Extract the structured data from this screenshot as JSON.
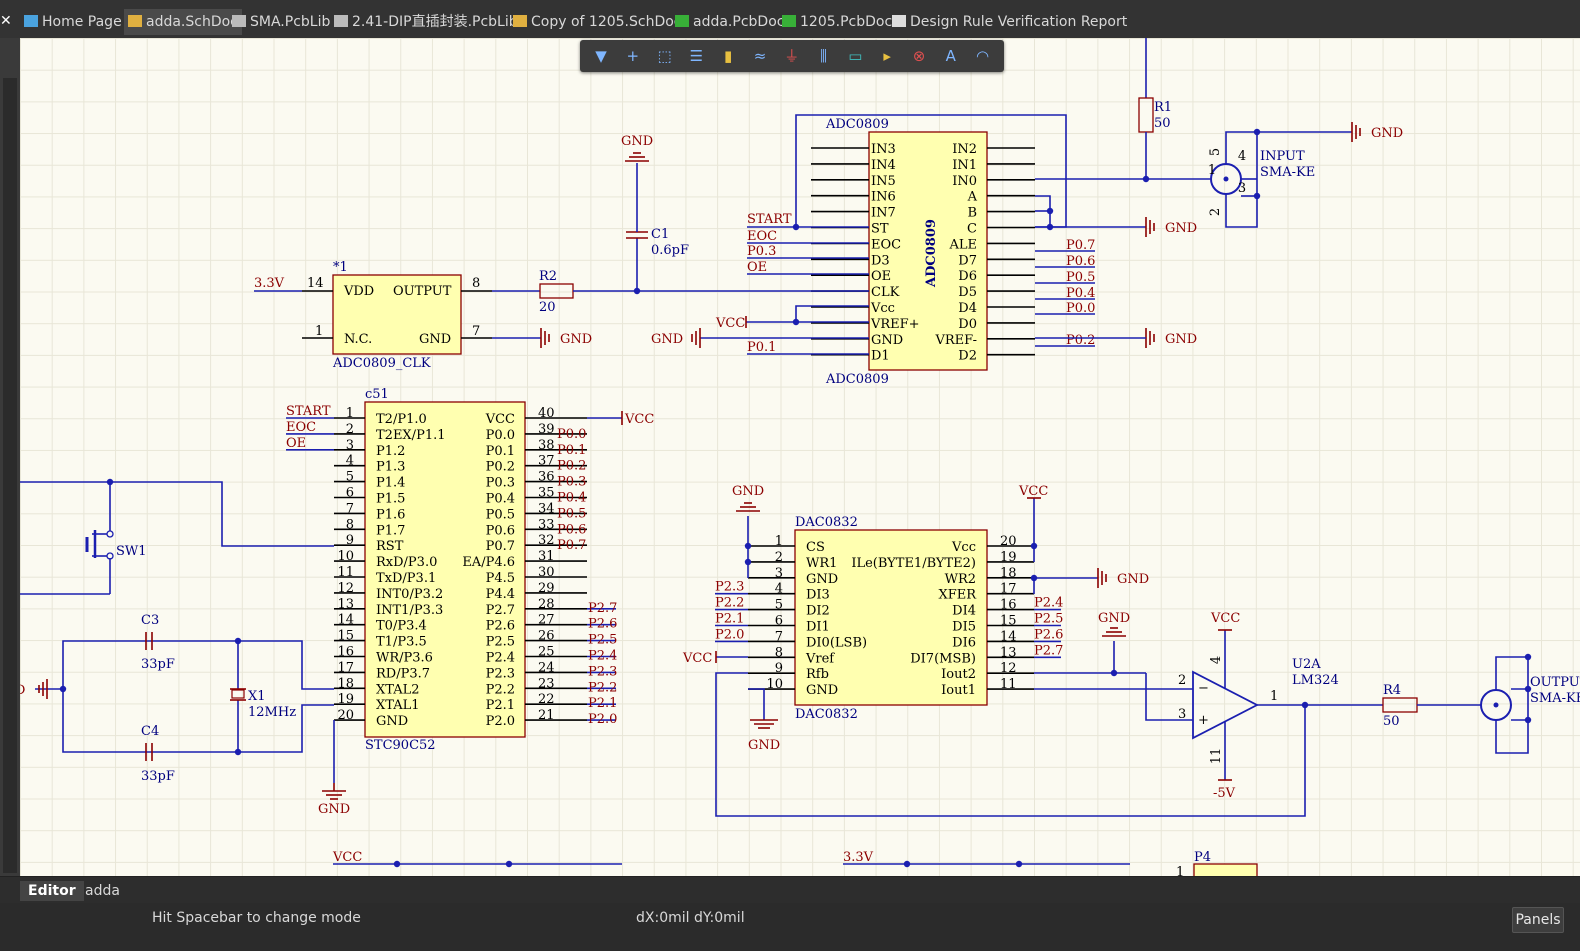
{
  "tabs": [
    {
      "label": "Home Page",
      "icon": "home-icon",
      "active": false
    },
    {
      "label": "adda.SchDoc",
      "icon": "schematic-doc-icon",
      "active": true
    },
    {
      "label": "SMA.PcbLib",
      "icon": "pcb-library-icon",
      "active": false
    },
    {
      "label": "2.41-DIP直插封装.PcbLib",
      "icon": "pcb-library-icon",
      "active": false
    },
    {
      "label": "Copy of 1205.SchDoc",
      "icon": "schematic-doc-icon",
      "active": false
    },
    {
      "label": "adda.PcbDoc",
      "icon": "pcb-doc-icon",
      "active": false
    },
    {
      "label": "1205.PcbDoc",
      "icon": "pcb-doc-icon",
      "active": false
    },
    {
      "label": "Design Rule Verification Report",
      "icon": "report-icon",
      "active": false
    }
  ],
  "toolbar": [
    "filter-icon",
    "crosshair-icon",
    "select-rect-icon",
    "align-icon",
    "component-icon",
    "wire-icon",
    "gnd-port-icon",
    "bus-icon",
    "sheet-symbol-icon",
    "net-label-icon",
    "no-erc-icon",
    "text-icon",
    "arc-icon"
  ],
  "schematic": {
    "colors": {
      "wire": "#1b1fb0",
      "net": "#8b0000",
      "label": "#00007f",
      "body": "#ffffb0",
      "outline": "#8b0000",
      "pin": "#000000"
    },
    "adc": {
      "designator": "ADC0809",
      "comment": "ADC0809",
      "title": "ADC0809",
      "left_pins": [
        "IN3",
        "IN4",
        "IN5",
        "IN6",
        "IN7",
        "ST",
        "EOC",
        "D3",
        "OE",
        "CLK",
        "Vcc",
        "VREF+",
        "GND",
        "D1"
      ],
      "right_pins": [
        "IN2",
        "IN1",
        "IN0",
        "A",
        "B",
        "C",
        "ALE",
        "D7",
        "D6",
        "D5",
        "D4",
        "D0",
        "VREF-",
        "D2"
      ],
      "left_nets": {
        "start": "START",
        "eoc": "EOC",
        "p03": "P0.3",
        "oe": "OE",
        "p01": "P0.1",
        "vcc": "VCC",
        "gnd": "GND"
      },
      "right_nets": [
        "P0.7",
        "P0.6",
        "P0.5",
        "P0.4",
        "P0.0",
        "P0.2"
      ]
    },
    "osc": {
      "designator": "*1",
      "comment": "ADC0809_CLK",
      "vdd": "VDD",
      "output": "OUTPUT",
      "nc": "N.C.",
      "gnd": "GND",
      "pin14": "14",
      "pin8": "8",
      "pin1": "1",
      "pin7": "7",
      "supply": "3.3V"
    },
    "r2": {
      "ref": "R2",
      "val": "20"
    },
    "c1": {
      "ref": "C1",
      "val": "0.6pF"
    },
    "r1": {
      "ref": "R1",
      "val": "50"
    },
    "input_conn": {
      "ref": "INPUT",
      "val": "SMA-KE",
      "pins": [
        "5",
        "4",
        "1",
        "3",
        "2"
      ]
    },
    "mcu": {
      "designator": "c51",
      "comment": "STC90C52",
      "left_pins": [
        "T2/P1.0",
        "T2EX/P1.1",
        "P1.2",
        "P1.3",
        "P1.4",
        "P1.5",
        "P1.6",
        "P1.7",
        "RST",
        "RxD/P3.0",
        "TxD/P3.1",
        "INT0/P3.2",
        "INT1/P3.3",
        "T0/P3.4",
        "T1/P3.5",
        "WR/P3.6",
        "RD/P3.7",
        "XTAL2",
        "XTAL1",
        "GND"
      ],
      "left_nums": [
        "1",
        "2",
        "3",
        "4",
        "5",
        "6",
        "7",
        "8",
        "9",
        "10",
        "11",
        "12",
        "13",
        "14",
        "15",
        "16",
        "17",
        "18",
        "19",
        "20"
      ],
      "right_pins": [
        "VCC",
        "P0.0",
        "P0.1",
        "P0.2",
        "P0.3",
        "P0.4",
        "P0.5",
        "P0.6",
        "P0.7",
        "EA/P4.6",
        "P4.5",
        "P4.4",
        "P2.7",
        "P2.6",
        "P2.5",
        "P2.4",
        "P2.3",
        "P2.2",
        "P2.1",
        "P2.0"
      ],
      "right_nums": [
        "40",
        "39",
        "38",
        "37",
        "36",
        "35",
        "34",
        "33",
        "32",
        "31",
        "30",
        "29",
        "28",
        "27",
        "26",
        "25",
        "24",
        "23",
        "22",
        "21"
      ],
      "left_nets": [
        "START",
        "EOC",
        "OE"
      ],
      "right_nets": [
        "VCC",
        "P0.0",
        "P0.1",
        "P0.2",
        "P0.3",
        "P0.4",
        "P0.5",
        "P0.6",
        "P0.7",
        "",
        "",
        "",
        "P2.7",
        "P2.6",
        "P2.5",
        "P2.4",
        "P2.3",
        "P2.2",
        "P2.1",
        "P2.0"
      ]
    },
    "sw1": {
      "ref": "SW1"
    },
    "c3": {
      "ref": "C3",
      "val": "33pF"
    },
    "c4": {
      "ref": "C4",
      "val": "33pF"
    },
    "x1": {
      "ref": "X1",
      "val": "12MHz"
    },
    "dac": {
      "designator": "DAC0832",
      "comment": "DAC0832",
      "left_pins": [
        "CS",
        "WR1",
        "GND",
        "DI3",
        "DI2",
        "DI1",
        "DI0(LSB)",
        "Vref",
        "Rfb",
        "GND"
      ],
      "left_nums": [
        "1",
        "2",
        "3",
        "4",
        "5",
        "6",
        "7",
        "8",
        "9",
        "10"
      ],
      "right_pins": [
        "Vcc",
        "ILe(BYTE1/BYTE2)",
        "WR2",
        "XFER",
        "DI4",
        "DI5",
        "DI6",
        "DI7(MSB)",
        "Iout2",
        "Iout1"
      ],
      "right_nums": [
        "20",
        "19",
        "18",
        "17",
        "16",
        "15",
        "14",
        "13",
        "12",
        "11"
      ],
      "left_nets": [
        "",
        "",
        "",
        "P2.3",
        "P2.2",
        "P2.1",
        "P2.0",
        "VCC",
        "",
        ""
      ],
      "right_nets": [
        "",
        "",
        "",
        "",
        "P2.4",
        "P2.5",
        "P2.6",
        "P2.7",
        "",
        ""
      ]
    },
    "u2": {
      "ref": "U2A",
      "val": "LM324",
      "pin2": "2",
      "pin3": "3",
      "pin1": "1",
      "pin4": "4",
      "pin11": "11",
      "vpos": "VCC",
      "vneg": "-5V"
    },
    "r4": {
      "ref": "R4",
      "val": "50"
    },
    "out_conn": {
      "ref": "OUTPUT",
      "val": "SMA-KE"
    },
    "bottom": {
      "vcc": "VCC",
      "v33": "3.3V",
      "p4": "P4",
      "p4pin": "1"
    },
    "gnd": "GND",
    "vcc": "VCC"
  },
  "editor_tabs": [
    {
      "label": "Editor",
      "active": true
    },
    {
      "label": "adda",
      "active": false
    }
  ],
  "status": {
    "message": "Hit Spacebar to change mode",
    "coords": "dX:0mil dY:0mil",
    "panels": "Panels"
  }
}
